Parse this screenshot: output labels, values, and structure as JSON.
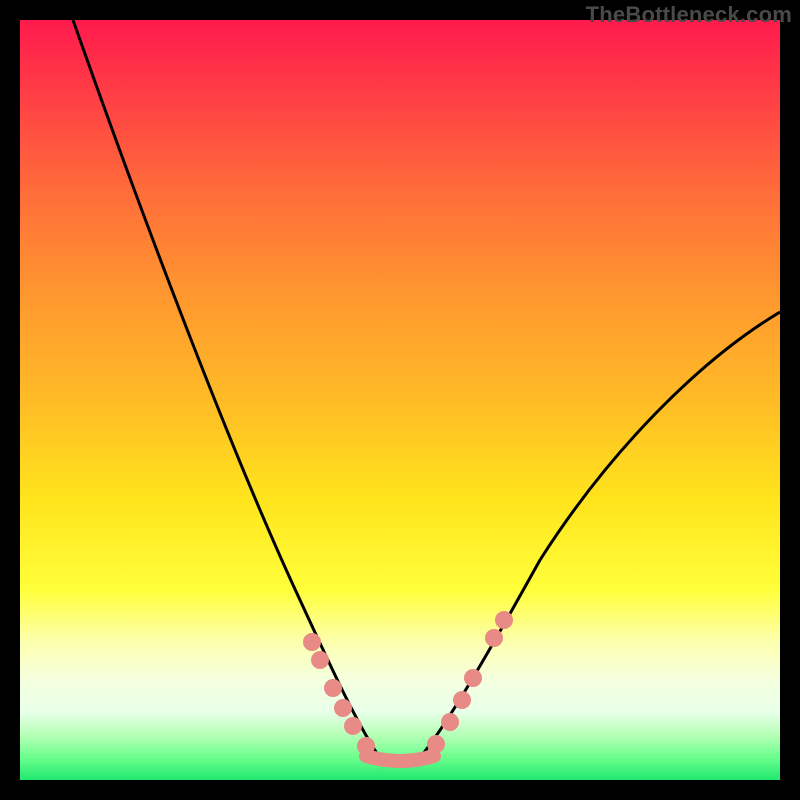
{
  "watermark": "TheBottleneck.com",
  "chart_data": {
    "type": "line",
    "title": "",
    "xlabel": "",
    "ylabel": "",
    "xlim": [
      0,
      100
    ],
    "ylim": [
      0,
      100
    ],
    "note": "Unlabeled bottleneck curve on a rainbow gradient. Values are estimated pixel-to-percent readings: x is horizontal position (0-100), y is curve height as percent of plot area (0 = bottom, 100 = top). Two curve segments meet at a flat trough near x≈47-52, y≈3.",
    "series": [
      {
        "name": "left-arm",
        "x": [
          7,
          12,
          17,
          22,
          27,
          32,
          36,
          40,
          43,
          46,
          48
        ],
        "y": [
          100,
          86,
          71,
          56,
          43,
          31,
          21,
          13,
          8,
          4,
          3
        ]
      },
      {
        "name": "right-arm",
        "x": [
          52,
          55,
          58,
          62,
          66,
          71,
          77,
          84,
          92,
          100
        ],
        "y": [
          3,
          5,
          9,
          15,
          22,
          30,
          39,
          48,
          56,
          62
        ]
      }
    ],
    "trough_flat": {
      "x_start": 46,
      "x_end": 54,
      "y": 3
    },
    "markers": {
      "description": "Salmon dots clustered along the lower portions of both arms and along the trough.",
      "color": "#e88a85",
      "points": [
        {
          "x": 38,
          "y": 17
        },
        {
          "x": 39.5,
          "y": 14
        },
        {
          "x": 41,
          "y": 11
        },
        {
          "x": 42.5,
          "y": 9
        },
        {
          "x": 44,
          "y": 7
        },
        {
          "x": 46,
          "y": 4
        },
        {
          "x": 47.5,
          "y": 3
        },
        {
          "x": 49,
          "y": 3
        },
        {
          "x": 50.5,
          "y": 3
        },
        {
          "x": 52,
          "y": 3
        },
        {
          "x": 54,
          "y": 4
        },
        {
          "x": 56,
          "y": 7
        },
        {
          "x": 57.5,
          "y": 10
        },
        {
          "x": 59,
          "y": 13
        },
        {
          "x": 62,
          "y": 19
        },
        {
          "x": 63.5,
          "y": 22
        }
      ]
    }
  }
}
